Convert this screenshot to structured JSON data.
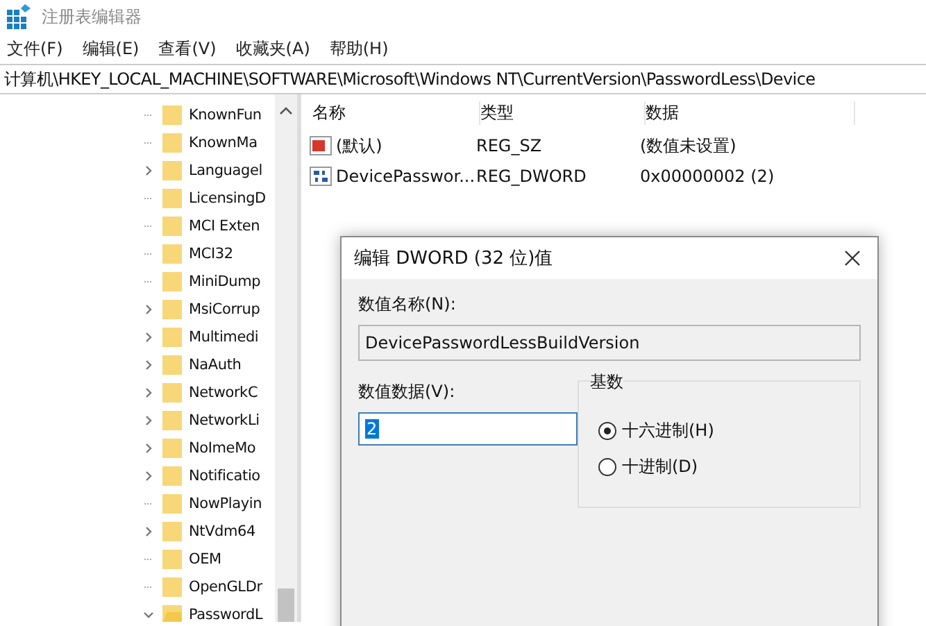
{
  "window": {
    "title": "注册表编辑器"
  },
  "menu": [
    "文件(F)",
    "编辑(E)",
    "查看(V)",
    "收藏夹(A)",
    "帮助(H)"
  ],
  "address": "计算机\\HKEY_LOCAL_MACHINE\\SOFTWARE\\Microsoft\\Windows NT\\CurrentVersion\\PasswordLess\\Device",
  "tree": [
    {
      "label": "KnownFun",
      "has_children": false,
      "expanded": false
    },
    {
      "label": "KnownMa",
      "has_children": false,
      "expanded": false
    },
    {
      "label": "Languagel",
      "has_children": true,
      "expanded": false
    },
    {
      "label": "LicensingD",
      "has_children": false,
      "expanded": false
    },
    {
      "label": "MCI Exten",
      "has_children": false,
      "expanded": false
    },
    {
      "label": "MCI32",
      "has_children": false,
      "expanded": false
    },
    {
      "label": "MiniDump",
      "has_children": false,
      "expanded": false
    },
    {
      "label": "MsiCorrup",
      "has_children": true,
      "expanded": false
    },
    {
      "label": "Multimedi",
      "has_children": true,
      "expanded": false
    },
    {
      "label": "NaAuth",
      "has_children": true,
      "expanded": false
    },
    {
      "label": "NetworkC",
      "has_children": true,
      "expanded": false
    },
    {
      "label": "NetworkLi",
      "has_children": true,
      "expanded": false
    },
    {
      "label": "NoImeMo",
      "has_children": true,
      "expanded": false
    },
    {
      "label": "Notificatio",
      "has_children": true,
      "expanded": false
    },
    {
      "label": "NowPlayin",
      "has_children": false,
      "expanded": false
    },
    {
      "label": "NtVdm64",
      "has_children": true,
      "expanded": false
    },
    {
      "label": "OEM",
      "has_children": false,
      "expanded": false
    },
    {
      "label": "OpenGLDr",
      "has_children": false,
      "expanded": false
    },
    {
      "label": "PasswordL",
      "has_children": true,
      "expanded": true
    }
  ],
  "values": {
    "columns": [
      "名称",
      "类型",
      "数据"
    ],
    "rows": [
      {
        "kind": "string",
        "name": "(默认)",
        "type": "REG_SZ",
        "data": "(数值未设置)"
      },
      {
        "kind": "binary",
        "name": "DevicePasswor...",
        "type": "REG_DWORD",
        "data": "0x00000002 (2)"
      }
    ]
  },
  "dialog": {
    "title": "编辑 DWORD (32 位)值",
    "name_label": "数值名称(N):",
    "name_value": "DevicePasswordLessBuildVersion",
    "data_label": "数值数据(V):",
    "data_value": "2",
    "base_label": "基数",
    "base_options": [
      {
        "label": "十六进制(H)",
        "selected": true
      },
      {
        "label": "十进制(D)",
        "selected": false
      }
    ]
  }
}
